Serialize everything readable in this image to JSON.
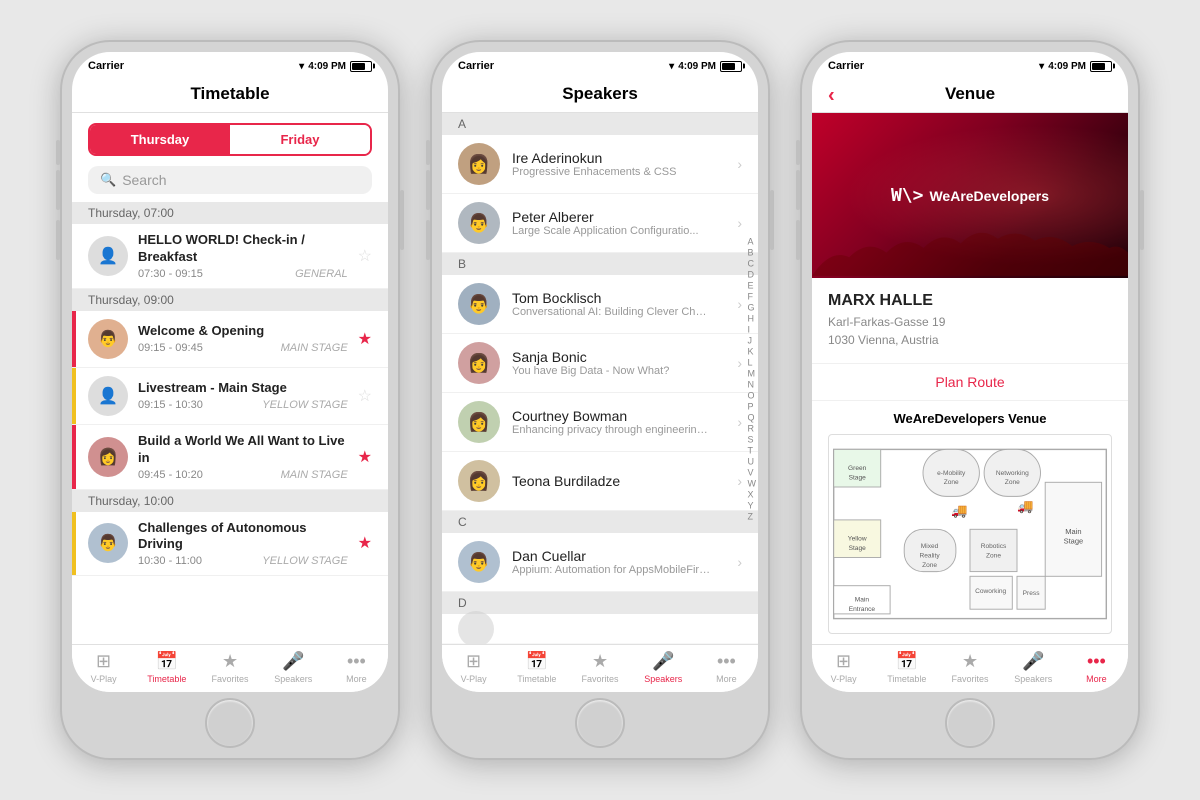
{
  "phones": [
    {
      "id": "timetable",
      "status": {
        "carrier": "Carrier",
        "wifi": "wifi",
        "time": "4:09 PM",
        "battery": 70
      },
      "nav_title": "Timetable",
      "segment": {
        "left": "Thursday",
        "right": "Friday",
        "active": "left"
      },
      "search_placeholder": "Search",
      "sections": [
        {
          "header": "Thursday, 07:00",
          "events": [
            {
              "title": "HELLO WORLD! Check-in / Breakfast",
              "time": "07:30 - 09:15",
              "stage": "GENERAL",
              "starred": false,
              "bar_color": "none",
              "avatar": "👤"
            }
          ]
        },
        {
          "header": "Thursday, 09:00",
          "events": [
            {
              "title": "Welcome & Opening",
              "time": "09:15 - 09:45",
              "stage": "MAIN STAGE",
              "starred": true,
              "bar_color": "red",
              "avatar": "👨"
            },
            {
              "title": "Livestream - Main Stage",
              "time": "09:15 - 10:30",
              "stage": "YELLOW STAGE",
              "starred": false,
              "bar_color": "yellow",
              "avatar": "👤"
            },
            {
              "title": "Build a World We All Want to Live in",
              "time": "09:45 - 10:20",
              "stage": "MAIN STAGE",
              "starred": true,
              "bar_color": "red",
              "avatar": "👩"
            }
          ]
        },
        {
          "header": "Thursday, 10:00",
          "events": [
            {
              "title": "Challenges of Autonomous Driving",
              "time": "10:30 - 11:00",
              "stage": "YELLOW STAGE",
              "starred": true,
              "bar_color": "yellow",
              "avatar": "👨"
            }
          ]
        }
      ],
      "tabs": [
        {
          "icon": "⊞",
          "label": "V-Play",
          "active": false
        },
        {
          "icon": "📅",
          "label": "Timetable",
          "active": true
        },
        {
          "icon": "★",
          "label": "Favorites",
          "active": false
        },
        {
          "icon": "🎤",
          "label": "Speakers",
          "active": false
        },
        {
          "icon": "···",
          "label": "More",
          "active": false
        }
      ]
    },
    {
      "id": "speakers",
      "status": {
        "carrier": "Carrier",
        "wifi": "wifi",
        "time": "4:09 PM",
        "battery": 70
      },
      "nav_title": "Speakers",
      "alpha_index": [
        "A",
        "B",
        "C",
        "D",
        "E",
        "F",
        "G",
        "H",
        "I",
        "J",
        "K",
        "L",
        "M",
        "N",
        "O",
        "P",
        "Q",
        "R",
        "S",
        "T",
        "U",
        "V",
        "W",
        "X",
        "Y",
        "Z"
      ],
      "sections": [
        {
          "letter": "A",
          "speakers": [
            {
              "name": "Ire Aderinokun",
              "topic": "Progressive Enhacements & CSS",
              "avatar": "👩"
            },
            {
              "name": "Peter Alberer",
              "topic": "Large Scale Application Configuratio...",
              "avatar": "👨"
            }
          ]
        },
        {
          "letter": "B",
          "speakers": [
            {
              "name": "Tom Bocklisch",
              "topic": "Conversational AI: Building Clever Chatbots",
              "avatar": "👨"
            },
            {
              "name": "Sanja Bonic",
              "topic": "You have Big Data - Now What?",
              "avatar": "👩"
            },
            {
              "name": "Courtney Bowman",
              "topic": "Enhancing privacy through engineering: ...",
              "avatar": "👩"
            },
            {
              "name": "Teona Burdiladze",
              "topic": "",
              "avatar": "👩"
            }
          ]
        },
        {
          "letter": "C",
          "speakers": [
            {
              "name": "Dan Cuellar",
              "topic": "Appium: Automation for AppsMobileFirst i...",
              "avatar": "👨"
            }
          ]
        },
        {
          "letter": "D",
          "speakers": []
        }
      ],
      "tabs": [
        {
          "icon": "⊞",
          "label": "V-Play",
          "active": false
        },
        {
          "icon": "📅",
          "label": "Timetable",
          "active": false
        },
        {
          "icon": "★",
          "label": "Favorites",
          "active": false
        },
        {
          "icon": "🎤",
          "label": "Speakers",
          "active": true
        },
        {
          "icon": "···",
          "label": "More",
          "active": false
        }
      ]
    },
    {
      "id": "venue",
      "status": {
        "carrier": "Carrier",
        "wifi": "wifi",
        "time": "4:09 PM",
        "battery": 70
      },
      "nav_title": "Venue",
      "back_label": "<",
      "venue_logo": "W\\> WeAreDevelopers",
      "venue_name": "MARX HALLE",
      "venue_address_line1": "Karl-Farkas-Gasse 19",
      "venue_address_line2": "1030 Vienna, Austria",
      "plan_route": "Plan Route",
      "map_title": "WeAreDevelopers Venue",
      "tabs": [
        {
          "icon": "⊞",
          "label": "V-Play",
          "active": false
        },
        {
          "icon": "📅",
          "label": "Timetable",
          "active": false
        },
        {
          "icon": "★",
          "label": "Favorites",
          "active": false
        },
        {
          "icon": "🎤",
          "label": "Speakers",
          "active": false
        },
        {
          "icon": "···",
          "label": "More",
          "active": true
        }
      ]
    }
  ]
}
